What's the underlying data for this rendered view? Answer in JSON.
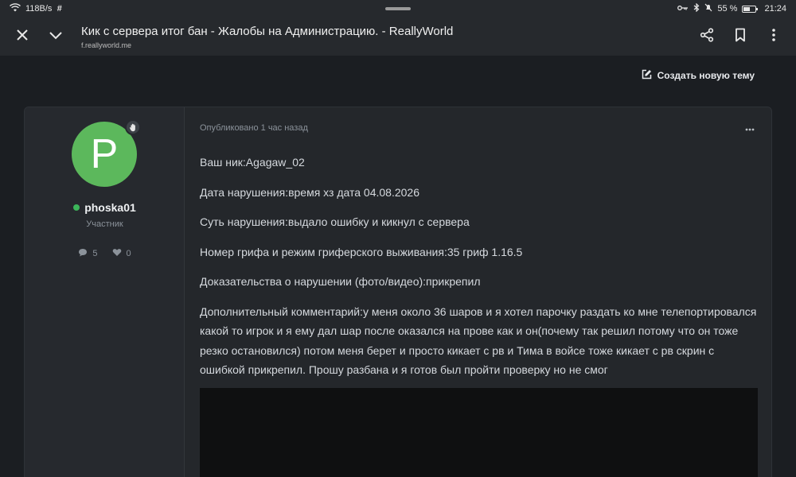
{
  "status_bar": {
    "speed": "118B/s",
    "battery_percent": "55 %",
    "time": "21:24"
  },
  "toolbar": {
    "page_title": "Кик с сервера итог бан - Жалобы на Администрацию. - ReallyWorld",
    "url": "f.reallyworld.me",
    "icons": [
      "close-icon",
      "chevron-down-icon",
      "share-icon",
      "bookmark-icon",
      "more-vert-icon"
    ]
  },
  "page": {
    "new_topic_label": "Создать новую тему"
  },
  "post": {
    "user": {
      "avatar_letter": "P",
      "avatar_color": "#5cb85c",
      "username": "phoska01",
      "role": "Участник",
      "messages_count": "5",
      "likes_count": "0",
      "online": true
    },
    "meta": "Опубликовано 1 час назад",
    "lines": [
      "Ваш ник:Agagaw_02",
      "Дата нарушения:время хз дата 04.08.2026",
      "Суть нарушения:выдало ошибку и кикнул с сервера",
      "Номер грифа и режим гриферского выживания:35 гриф 1.16.5",
      "Доказательства о нарушении (фото/видео):прикрепил",
      "Дополнительный комментарий:у меня около 36 шаров и я хотел парочку раздать ко мне телепортировался какой то игрок и я ему дал шар после оказался на прове как и он(почему так решил потому что он тоже резко остановился) потом меня берет и просто кикает с рв и Тима в войсе тоже кикает с рв скрин с ошибкой прикрепил. Прошу разбана и я готов был пройти проверку но не смог"
    ]
  }
}
